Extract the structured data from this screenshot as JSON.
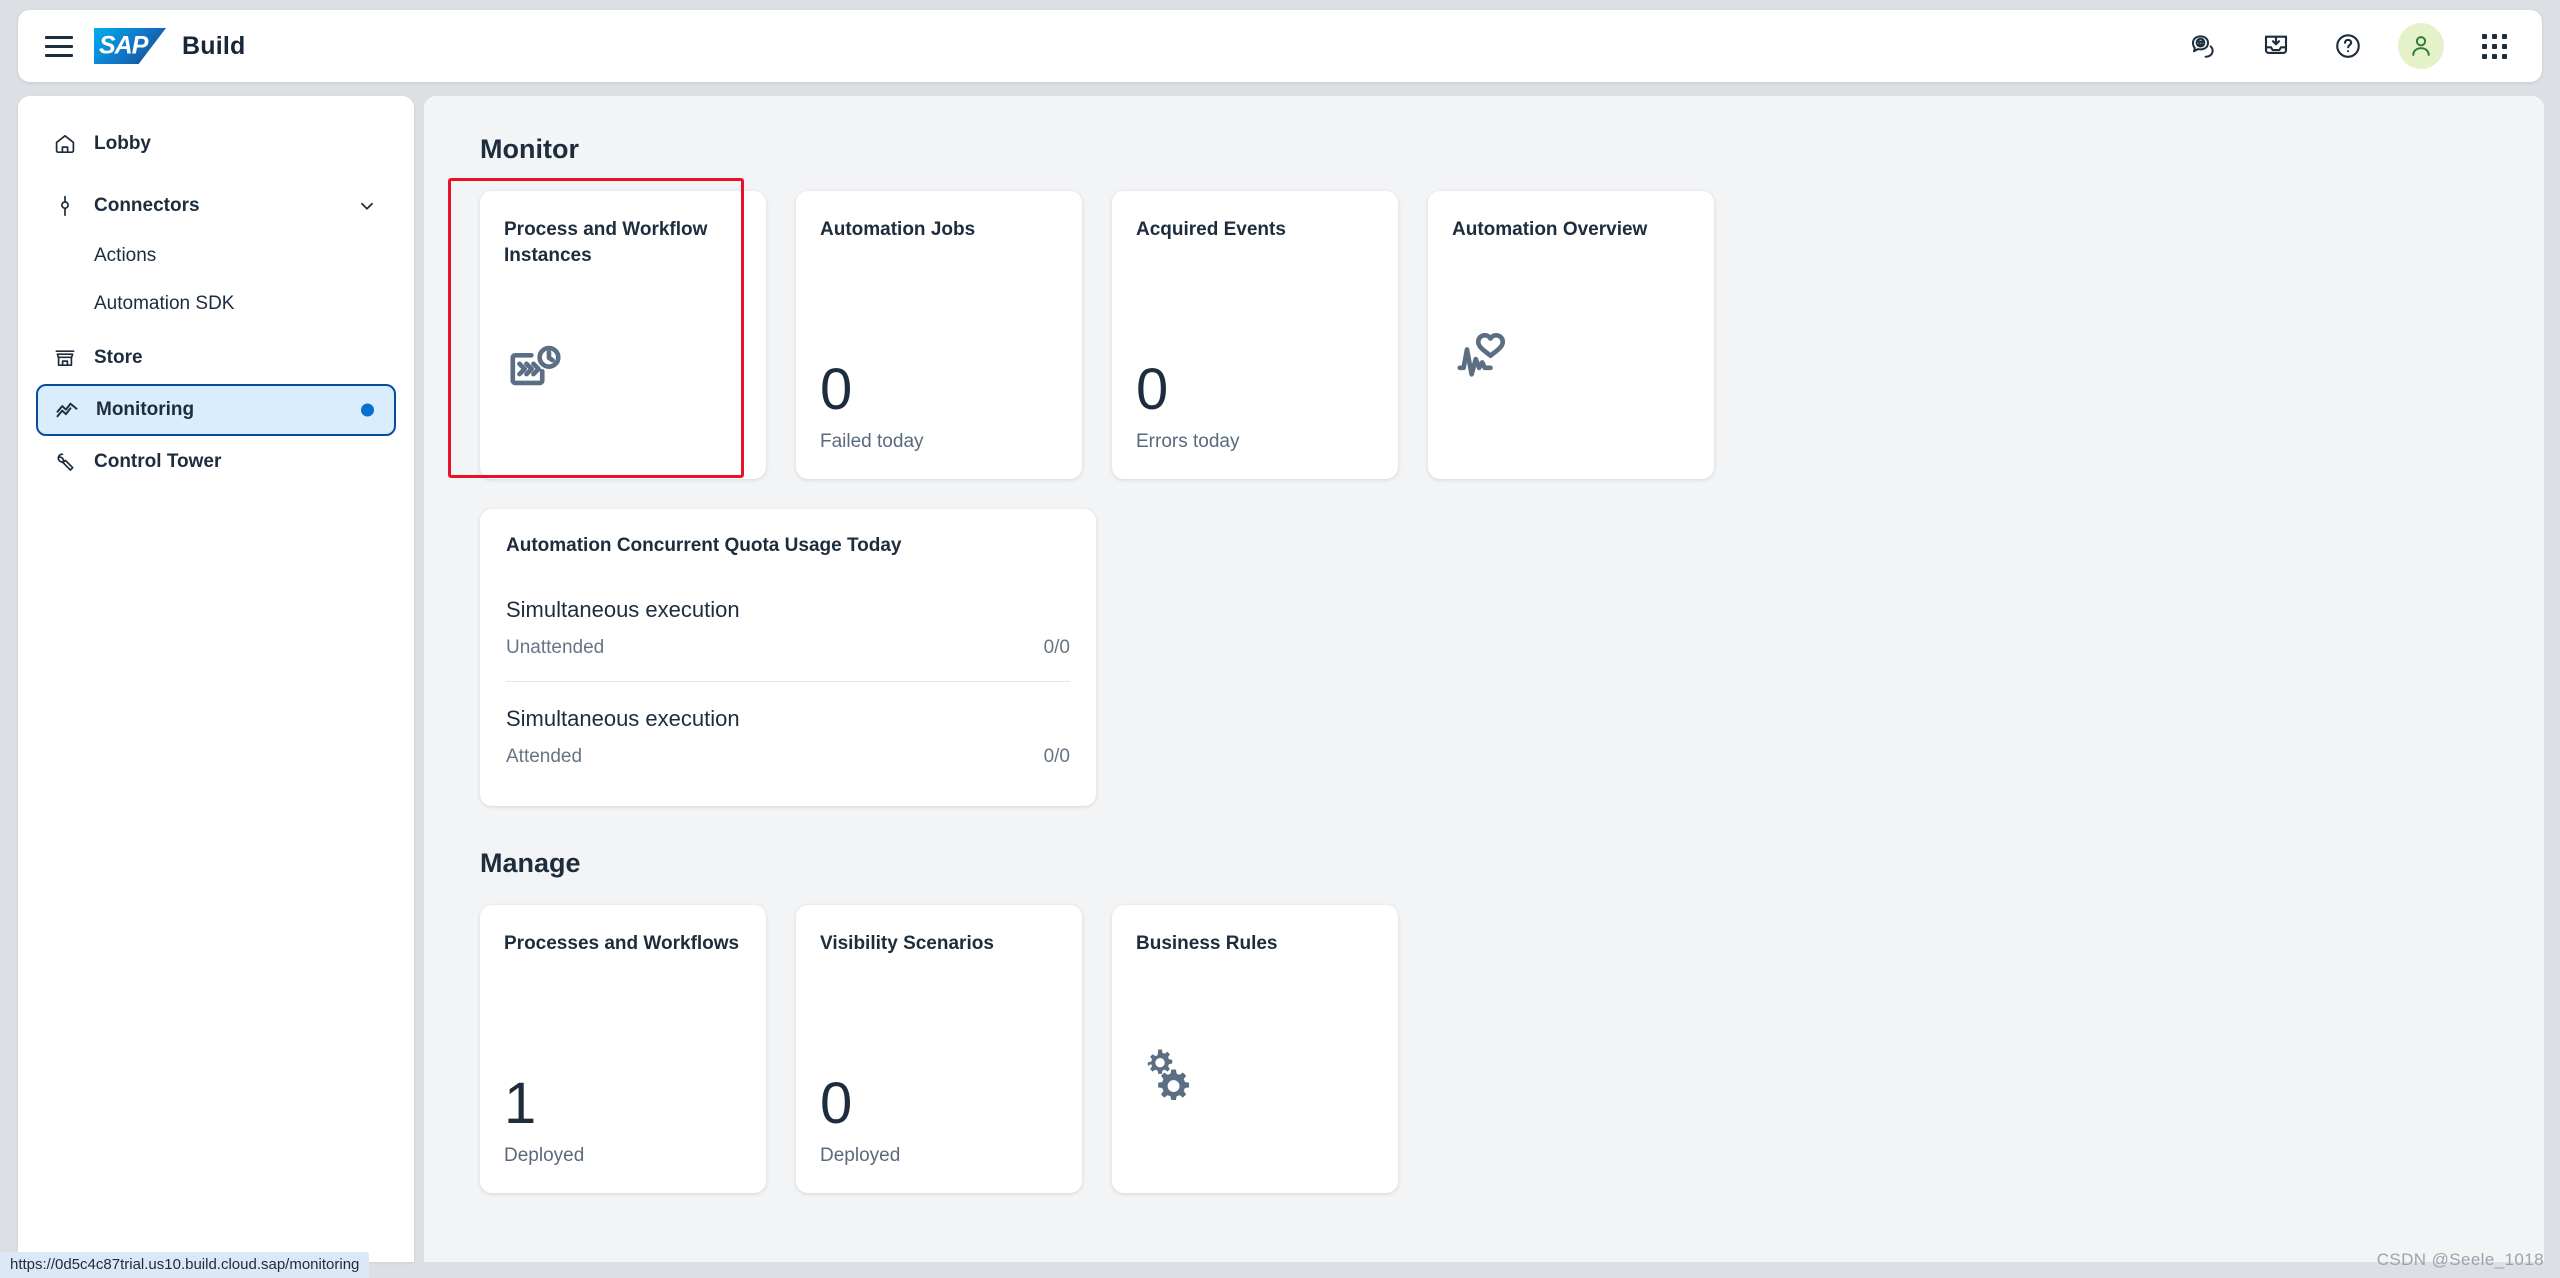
{
  "topbar": {
    "menu_icon": "hamburger-icon",
    "logo_text": "SAP",
    "app_title": "Build",
    "actions": [
      {
        "name": "feedback-icon",
        "label": "Feedback"
      },
      {
        "name": "inbox-download-icon",
        "label": "Inbox"
      },
      {
        "name": "help-icon",
        "label": "Help"
      },
      {
        "name": "user-avatar-icon",
        "label": "User"
      },
      {
        "name": "app-grid-icon",
        "label": "Apps"
      }
    ]
  },
  "sidebar": {
    "items": [
      {
        "label": "Lobby",
        "icon": "home-icon",
        "active": false,
        "sub": false
      },
      {
        "label": "Connectors",
        "icon": "connector-icon",
        "active": false,
        "sub": false,
        "expandable": true
      },
      {
        "label": "Actions",
        "icon": "",
        "active": false,
        "sub": true
      },
      {
        "label": "Automation SDK",
        "icon": "",
        "active": false,
        "sub": true
      },
      {
        "label": "Store",
        "icon": "store-icon",
        "active": false,
        "sub": false
      },
      {
        "label": "Monitoring",
        "icon": "monitoring-icon",
        "active": true,
        "sub": false,
        "dot": true
      },
      {
        "label": "Control Tower",
        "icon": "wrench-icon",
        "active": false,
        "sub": false
      }
    ]
  },
  "main": {
    "monitor": {
      "heading": "Monitor",
      "tiles": [
        {
          "title": "Process and Workflow Instances",
          "kind": "icon",
          "icon": "process-instances-icon",
          "highlighted": true
        },
        {
          "title": "Automation Jobs",
          "kind": "number",
          "value": "0",
          "subtitle": "Failed today"
        },
        {
          "title": "Acquired Events",
          "kind": "number",
          "value": "0",
          "subtitle": "Errors today"
        },
        {
          "title": "Automation Overview",
          "kind": "icon",
          "icon": "heartbeat-icon"
        }
      ],
      "quota": {
        "title": "Automation Concurrent Quota Usage Today",
        "rows": [
          {
            "main": "Simultaneous execution",
            "label": "Unattended",
            "value": "0/0"
          },
          {
            "main": "Simultaneous execution",
            "label": "Attended",
            "value": "0/0"
          }
        ]
      }
    },
    "manage": {
      "heading": "Manage",
      "tiles": [
        {
          "title": "Processes and Workflows",
          "kind": "number",
          "value": "1",
          "subtitle": "Deployed"
        },
        {
          "title": "Visibility Scenarios",
          "kind": "number",
          "value": "0",
          "subtitle": "Deployed"
        },
        {
          "title": "Business Rules",
          "kind": "icon",
          "icon": "gears-icon"
        }
      ]
    }
  },
  "statusbar": {
    "url": "https://0d5c4c87trial.us10.build.cloud.sap/monitoring"
  },
  "watermark": {
    "text": "CSDN @Seele_1018"
  },
  "colors": {
    "accent": "#0a6ed1",
    "active_bg": "#d9edfd",
    "active_border": "#0a4ba0",
    "highlight": "#e8132a",
    "icon": "#5b6e84",
    "avatar_bg": "#e5f2c9",
    "avatar_fg": "#2a7a3c"
  }
}
